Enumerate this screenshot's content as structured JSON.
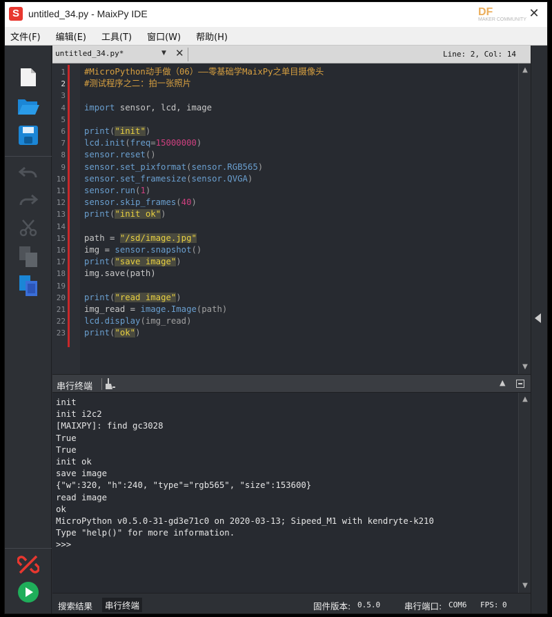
{
  "window": {
    "title": "untitled_34.py - MaixPy IDE",
    "logo_letter": "S",
    "watermark": "DF",
    "watermark_sub": "MAKER COMMUNITY"
  },
  "menu": {
    "items": [
      "文件(F)",
      "编辑(E)",
      "工具(T)",
      "窗口(W)",
      "帮助(H)"
    ]
  },
  "tab": {
    "filename": "untitled_34.py*",
    "cursor_position": "Line: 2, Col: 14"
  },
  "editor": {
    "current_line": 2,
    "lines": [
      [
        [
          "cm",
          "#MicroPython动手做（06）——零基础学MaixPy之单目摄像头"
        ]
      ],
      [
        [
          "cm",
          "#测试程序之二：拍一张照片"
        ]
      ],
      [],
      [
        [
          "kw",
          "import"
        ],
        [
          "fn",
          " sensor, lcd, image"
        ]
      ],
      [],
      [
        [
          "kw",
          "print"
        ],
        [
          "pn",
          "("
        ],
        [
          "st",
          "\"init\""
        ],
        [
          "pn",
          ")"
        ]
      ],
      [
        [
          "kw",
          "lcd.init"
        ],
        [
          "pn",
          "("
        ],
        [
          "kw",
          "freq"
        ],
        [
          "pn",
          "="
        ],
        [
          "nm",
          "15000000"
        ],
        [
          "pn",
          ")"
        ]
      ],
      [
        [
          "kw",
          "sensor.reset"
        ],
        [
          "pn",
          "()"
        ]
      ],
      [
        [
          "kw",
          "sensor.set_pixformat"
        ],
        [
          "pn",
          "("
        ],
        [
          "kw",
          "sensor.RGB565"
        ],
        [
          "pn",
          ")"
        ]
      ],
      [
        [
          "kw",
          "sensor.set_framesize"
        ],
        [
          "pn",
          "("
        ],
        [
          "kw",
          "sensor.QVGA"
        ],
        [
          "pn",
          ")"
        ]
      ],
      [
        [
          "kw",
          "sensor.run"
        ],
        [
          "pn",
          "("
        ],
        [
          "nm",
          "1"
        ],
        [
          "pn",
          ")"
        ]
      ],
      [
        [
          "kw",
          "sensor.skip_frames"
        ],
        [
          "pn",
          "("
        ],
        [
          "nm",
          "40"
        ],
        [
          "pn",
          ")"
        ]
      ],
      [
        [
          "kw",
          "print"
        ],
        [
          "pn",
          "("
        ],
        [
          "st",
          "\"init ok\""
        ],
        [
          "pn",
          ")"
        ]
      ],
      [],
      [
        [
          "fn",
          "path = "
        ],
        [
          "st",
          "\"/sd/image.jpg\""
        ]
      ],
      [
        [
          "fn",
          "img = "
        ],
        [
          "kw",
          "sensor.snapshot"
        ],
        [
          "pn",
          "()"
        ]
      ],
      [
        [
          "kw",
          "print"
        ],
        [
          "pn",
          "("
        ],
        [
          "st",
          "\"save image\""
        ],
        [
          "pn",
          ")"
        ]
      ],
      [
        [
          "fn",
          "img.save(path)"
        ]
      ],
      [],
      [
        [
          "kw",
          "print"
        ],
        [
          "pn",
          "("
        ],
        [
          "st",
          "\"read image\""
        ],
        [
          "pn",
          ")"
        ]
      ],
      [
        [
          "fn",
          "img_read = "
        ],
        [
          "kw",
          "image.Image"
        ],
        [
          "pn",
          "(path)"
        ]
      ],
      [
        [
          "kw",
          "lcd.display"
        ],
        [
          "pn",
          "(img_read)"
        ]
      ],
      [
        [
          "kw",
          "print"
        ],
        [
          "pn",
          "("
        ],
        [
          "st",
          "\"ok\""
        ],
        [
          "pn",
          ")"
        ]
      ]
    ]
  },
  "terminal": {
    "title": "串行终端",
    "lines": [
      "init",
      "init i2c2",
      "[MAIXPY]: find gc3028",
      "True",
      "True",
      "init ok",
      "save image",
      "{\"w\":320, \"h\":240, \"type\"=\"rgb565\", \"size\":153600}",
      "read image",
      "ok",
      "MicroPython v0.5.0-31-gd3e71c0 on 2020-03-13; Sipeed_M1 with kendryte-k210",
      "Type \"help()\" for more information.",
      ">>>"
    ]
  },
  "status": {
    "search_results": "搜索结果",
    "serial_terminal": "串行终端",
    "firmware_label": "固件版本:",
    "firmware_value": "0.5.0",
    "port_label": "串行端口:",
    "port_value": "COM6",
    "fps_label": "FPS:",
    "fps_value": "0"
  },
  "colors": {
    "accent_red": "#e8372f",
    "toolbar_blue": "#1b86d6",
    "run_green": "#1fae5a"
  }
}
